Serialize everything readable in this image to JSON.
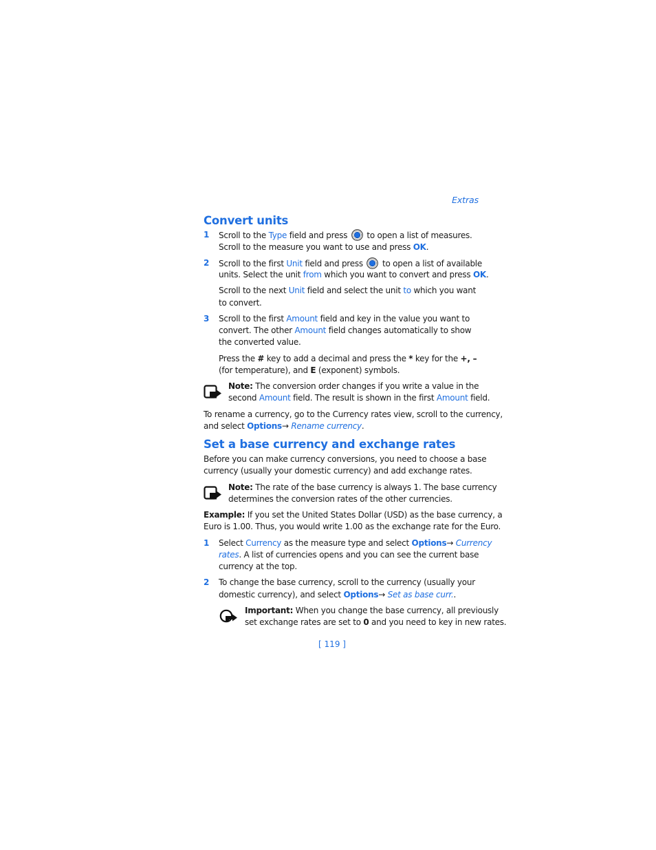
{
  "header": {
    "running_head": "Extras"
  },
  "section1": {
    "title": "Convert units",
    "step1": {
      "num": "1",
      "line1": [
        "Scroll to the ",
        "Type",
        " field and press ",
        " to open a list of measures."
      ],
      "line2": [
        "Scroll to the measure you want to use and press ",
        "OK",
        "."
      ]
    },
    "step2": {
      "num": "2",
      "line1": [
        "Scroll to the first ",
        "Unit",
        " field and press ",
        " to open a list of available"
      ],
      "line2": [
        "units. Select the unit ",
        "from",
        " which you want to convert and press ",
        "OK",
        "."
      ],
      "line3": [
        "Scroll to the next ",
        "Unit",
        " field and select the unit ",
        "to",
        " which you want"
      ],
      "line4": "to convert."
    },
    "step3": {
      "num": "3",
      "line1": [
        "Scroll to the first ",
        "Amount",
        " field and key in the value you want to"
      ],
      "line2": [
        "convert. The other ",
        "Amount",
        " field changes automatically to show"
      ],
      "line3": "the converted value.",
      "line4": [
        "Press the ",
        "#",
        " key to add a decimal and press the ",
        "*",
        " key for the ",
        "+, –"
      ],
      "line5": [
        "(for temperature), and ",
        "E",
        " (exponent) symbols."
      ]
    },
    "note": {
      "line1": [
        "Note:",
        " The conversion order changes if you write a value in the"
      ],
      "line2": [
        "second ",
        "Amount",
        " field. The result is shown in the first ",
        "Amount",
        " field."
      ]
    },
    "rename": {
      "line1": "To rename a currency, go to the Currency rates view, scroll to the currency,",
      "line2": [
        "and select ",
        "Options",
        "→ ",
        "Rename currency",
        "."
      ]
    }
  },
  "section2": {
    "title": "Set a base currency and exchange rates",
    "intro": {
      "line1": "Before you can make currency conversions, you need to choose a base",
      "line2": "currency (usually your domestic currency) and add exchange rates."
    },
    "note": {
      "line1": [
        "Note:",
        " The rate of the base currency is always 1. The base currency"
      ],
      "line2": "determines the conversion rates of the other currencies."
    },
    "example": {
      "line1": [
        "Example:",
        " If you set the United States Dollar (USD) as the base currency, a"
      ],
      "line2": "Euro is 1.00. Thus, you would write 1.00 as the exchange rate for the Euro."
    },
    "step1": {
      "num": "1",
      "line1": [
        "Select ",
        "Currency",
        " as the measure type and select ",
        "Options",
        "→ ",
        "Currency"
      ],
      "line2": [
        "rates",
        ". A list of currencies opens and you can see the current base"
      ],
      "line3": "currency at the top."
    },
    "step2": {
      "num": "2",
      "line1": "To change the base currency, scroll to the currency (usually your",
      "line2": [
        "domestic currency), and select ",
        "Options",
        "→ ",
        "Set as base curr.",
        "."
      ]
    },
    "important": {
      "line1": [
        "Important:",
        " When you change the base currency, all previously"
      ],
      "line2": [
        "set exchange rates are set to ",
        "0",
        " and you need to key in new rates."
      ]
    }
  },
  "footer": {
    "page_number": "[ 119 ]"
  },
  "colors": {
    "accent": "#1f6fe0",
    "text": "#1a1a1a"
  },
  "icons": {
    "select_key": "navi-key-icon",
    "note": "note-icon",
    "important": "important-icon"
  }
}
